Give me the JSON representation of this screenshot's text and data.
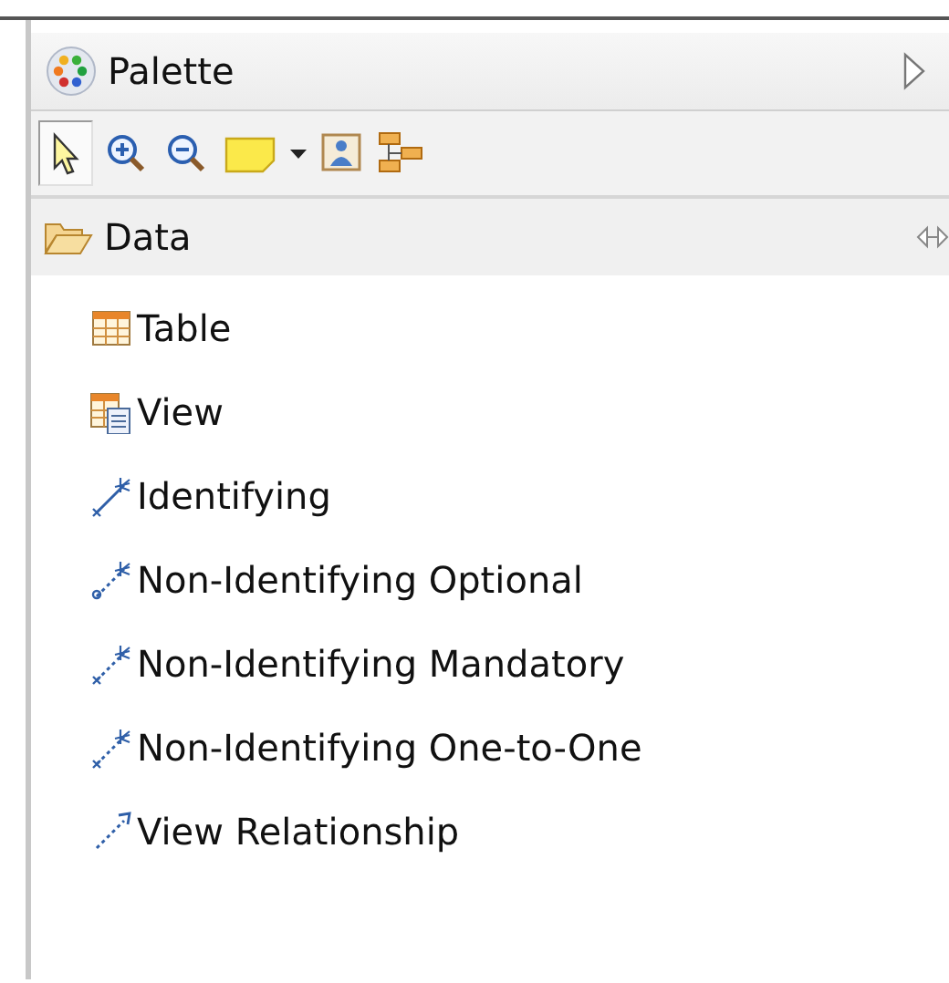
{
  "palette": {
    "title": "Palette"
  },
  "toolbar": [
    {
      "kind": "select",
      "selected": true
    },
    {
      "kind": "zoom-in",
      "selected": false
    },
    {
      "kind": "zoom-out",
      "selected": false
    },
    {
      "kind": "note",
      "selected": false
    },
    {
      "kind": "dropdown",
      "selected": false
    },
    {
      "kind": "image",
      "selected": false
    },
    {
      "kind": "layout",
      "selected": false
    }
  ],
  "drawer": {
    "label": "Data",
    "expanded": true,
    "items": [
      {
        "label": "Table",
        "kind": "table"
      },
      {
        "label": "View",
        "kind": "view"
      },
      {
        "label": "Identifying",
        "kind": "identifying"
      },
      {
        "label": "Non-Identifying Optional",
        "kind": "optional"
      },
      {
        "label": "Non-Identifying Mandatory",
        "kind": "mandatory"
      },
      {
        "label": "Non-Identifying One-to-One",
        "kind": "one-to-one"
      },
      {
        "label": "View Relationship",
        "kind": "view-relationship"
      }
    ]
  }
}
